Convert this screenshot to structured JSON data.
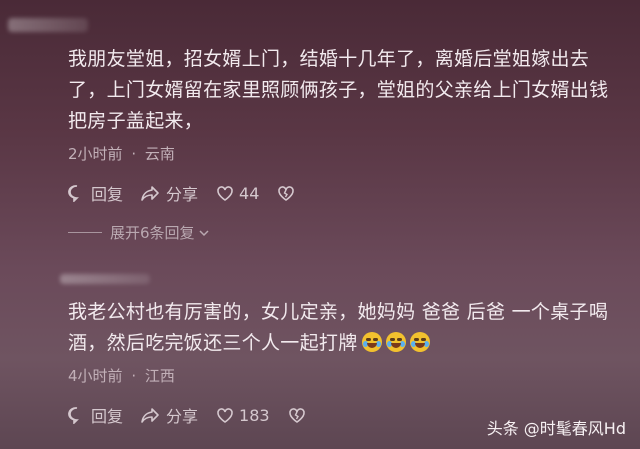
{
  "comments": [
    {
      "text": "我朋友堂姐，招女婿上门，结婚十几年了，离婚后堂姐嫁出去了，上门女婿留在家里照顾俩孩子，堂姐的父亲给上门女婿出钱把房子盖起来，",
      "time": "2小时前",
      "separator": "·",
      "location": "云南",
      "reply_label": "回复",
      "share_label": "分享",
      "like_count": "44",
      "expand_label": "展开6条回复"
    },
    {
      "text": "我老公村也有厉害的，女儿定亲，她妈妈 爸爸 后爸 一个桌子喝酒，然后吃完饭还三个人一起打牌",
      "time": "4小时前",
      "separator": "·",
      "location": "江西",
      "reply_label": "回复",
      "share_label": "分享",
      "like_count": "183"
    }
  ],
  "watermark": "头条 @时髦春风Hd",
  "colors": {
    "background_top": "#4a2a37",
    "background_bottom": "#6f5461",
    "text": "#f2eaee",
    "meta": "#c2b0b8"
  }
}
